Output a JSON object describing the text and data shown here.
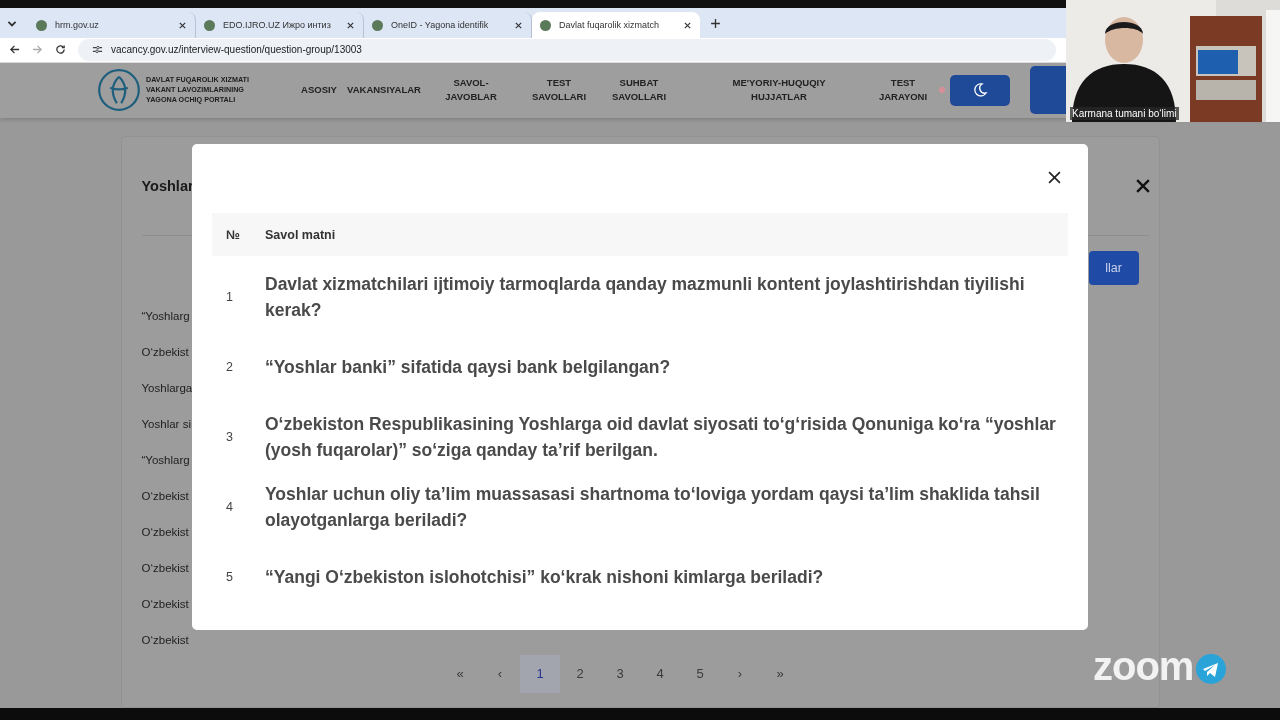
{
  "browser": {
    "tabs": [
      {
        "title": "hrm.gov.uz",
        "selected": false
      },
      {
        "title": "EDO.IJRO.UZ Ижро интиз",
        "selected": false
      },
      {
        "title": "OneID - Yagona identifik",
        "selected": false
      },
      {
        "title": "Davlat fuqarolik xizmatch",
        "selected": true
      }
    ],
    "address": "vacancy.gov.uz/interview-question/question-group/13003"
  },
  "header": {
    "logo_lines": [
      "DAVLAT FUQAROLIK XIZMATI",
      "VAKANT LAVOZIMLARINING",
      "YAGONA OCHIQ PORTALI"
    ],
    "nav": [
      {
        "lines": [
          "ASOSIY"
        ]
      },
      {
        "lines": [
          "VAKANSIYALAR"
        ]
      },
      {
        "lines": [
          "SAVOL-",
          "JAVOBLAR"
        ]
      },
      {
        "lines": [
          "TEST",
          "SAVOLLARI"
        ]
      },
      {
        "lines": [
          "SUHBAT",
          "SAVOLLARI"
        ]
      },
      {
        "lines": [
          "ME'YORIY-HUQUQIY",
          "HUJJATLAR"
        ]
      },
      {
        "lines": [
          "TEST",
          "JARAYONI"
        ]
      }
    ]
  },
  "background_card": {
    "title": "Yoshlar",
    "button": "llar",
    "items": [
      "“Yoshlarg",
      "O‘zbekist",
      "Yoshlarga",
      "Yoshlar si",
      "“Yoshlarg",
      "O‘zbekist",
      "O‘zbekist",
      "O‘zbekist",
      "O‘zbekist",
      "O‘zbekist"
    ],
    "pagination": [
      {
        "label": "«",
        "selected": false
      },
      {
        "label": "‹",
        "selected": false
      },
      {
        "label": "1",
        "selected": true
      },
      {
        "label": "2",
        "selected": false
      },
      {
        "label": "3",
        "selected": false
      },
      {
        "label": "4",
        "selected": false
      },
      {
        "label": "5",
        "selected": false
      },
      {
        "label": "›",
        "selected": false
      },
      {
        "label": "»",
        "selected": false
      }
    ]
  },
  "modal": {
    "columns": [
      "№",
      "Savol matni"
    ],
    "rows": [
      {
        "number": "1",
        "question": "Davlat xizmatchilari ijtimoiy tarmoqlarda qanday mazmunli kontent joylashtirishdan tiyilishi kerak?"
      },
      {
        "number": "2",
        "question": "“Yoshlar banki” sifatida qaysi bank belgilangan?"
      },
      {
        "number": "3",
        "question": "O‘zbekiston Respublikasining Yoshlarga oid davlat siyosati to‘g‘risida Qonuniga ko‘ra “yoshlar (yosh fuqarolar)” so‘ziga qanday ta’rif berilgan."
      },
      {
        "number": "4",
        "question": "Yoshlar uchun oliy ta’lim muassasasi shartnoma to‘loviga yordam qaysi ta’lim shaklida tahsil olayotganlarga beriladi?"
      },
      {
        "number": "5",
        "question": "“Yangi O‘zbekiston islohotchisi” ko‘krak nishoni kimlarga beriladi?"
      }
    ]
  },
  "video": {
    "participant": "Karmana tumani bo‘limi"
  },
  "zoom_logo": "zoom"
}
